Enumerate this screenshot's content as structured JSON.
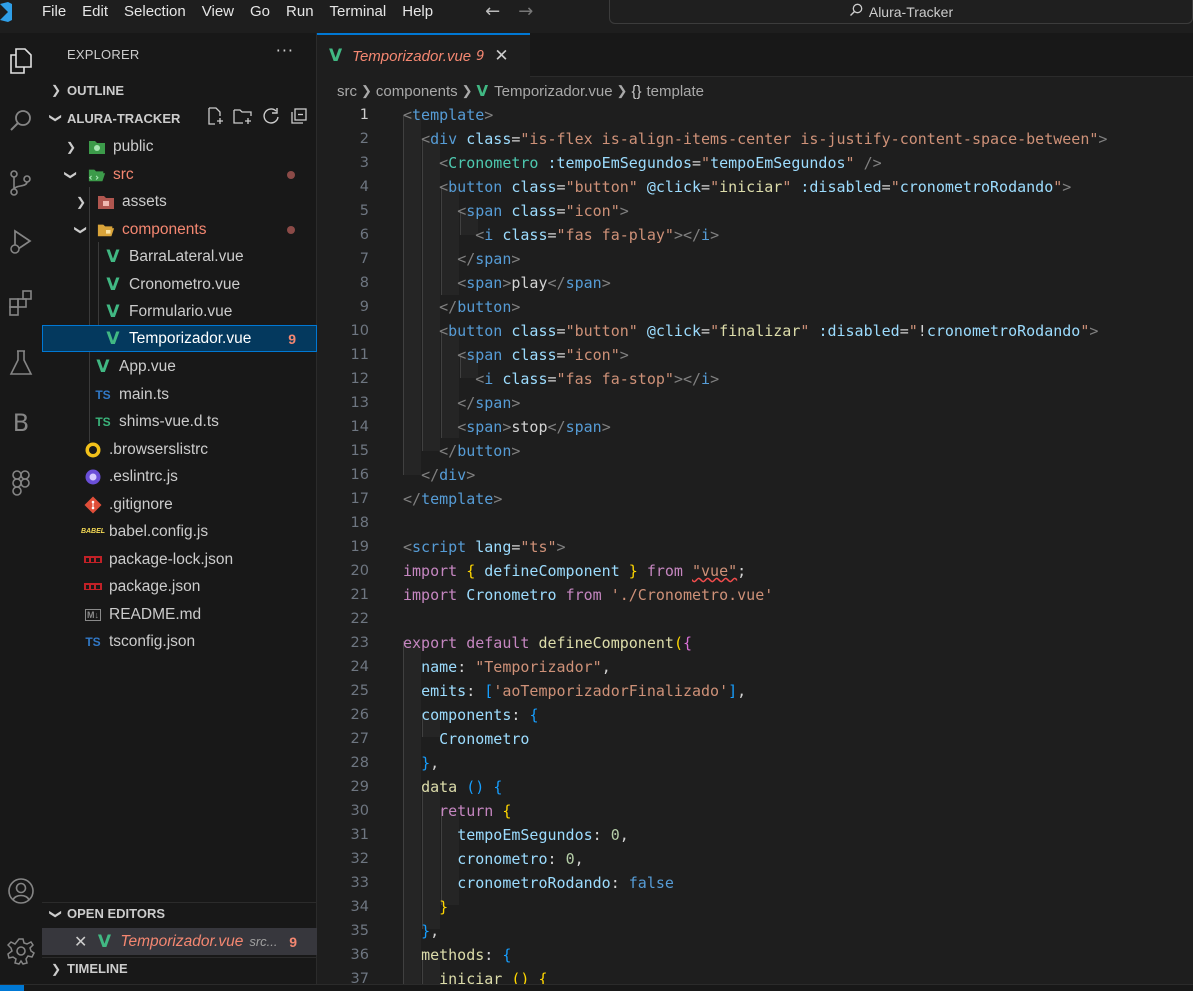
{
  "titlebar": {
    "menu": [
      "File",
      "Edit",
      "Selection",
      "View",
      "Go",
      "Run",
      "Terminal",
      "Help"
    ],
    "search_text": "Alura-Tracker"
  },
  "activity": {
    "icons": [
      "explorer-icon",
      "search-icon",
      "source-control-icon",
      "run-debug-icon",
      "extensions-icon",
      "testing-icon",
      "b-extension-icon",
      "figma-icon",
      "account-icon",
      "settings-gear-icon"
    ],
    "b_letter": "B"
  },
  "sidebar": {
    "title": "EXPLORER",
    "more": "···",
    "outline": "OUTLINE",
    "project": "ALURA-TRACKER",
    "tree": [
      {
        "label": "public",
        "kind": "folder"
      },
      {
        "label": "src",
        "kind": "folder-open"
      },
      {
        "label": "assets",
        "kind": "folder"
      },
      {
        "label": "components",
        "kind": "folder-open"
      },
      {
        "label": "BarraLateral.vue",
        "kind": "vue"
      },
      {
        "label": "Cronometro.vue",
        "kind": "vue"
      },
      {
        "label": "Formulario.vue",
        "kind": "vue"
      },
      {
        "label": "Temporizador.vue",
        "kind": "vue",
        "badge": "9"
      },
      {
        "label": "App.vue",
        "kind": "vue"
      },
      {
        "label": "main.ts",
        "kind": "ts",
        "icon_text": "TS"
      },
      {
        "label": "shims-vue.d.ts",
        "kind": "ts",
        "icon_text": "TS"
      },
      {
        "label": ".browserslistrc",
        "kind": "file"
      },
      {
        "label": ".eslintrc.js",
        "kind": "file"
      },
      {
        "label": ".gitignore",
        "kind": "file"
      },
      {
        "label": "babel.config.js",
        "kind": "file",
        "icon_text": "BABEL"
      },
      {
        "label": "package-lock.json",
        "kind": "file"
      },
      {
        "label": "package.json",
        "kind": "file"
      },
      {
        "label": "README.md",
        "kind": "file",
        "icon_text": "M↓"
      },
      {
        "label": "tsconfig.json",
        "kind": "file",
        "icon_text": "TS"
      }
    ],
    "open_editors": "OPEN EDITORS",
    "open_editor_item": {
      "label": "Temporizador.vue",
      "path": "src...",
      "badge": "9"
    },
    "timeline": "TIMELINE"
  },
  "editor": {
    "tab": {
      "label": "Temporizador.vue",
      "badge": "9"
    },
    "breadcrumb": [
      "src",
      "components",
      "Temporizador.vue",
      "template"
    ],
    "braces": "{}"
  },
  "colors": {
    "accent": "#0078d4",
    "error": "#f48771",
    "vue": "#41b883"
  }
}
